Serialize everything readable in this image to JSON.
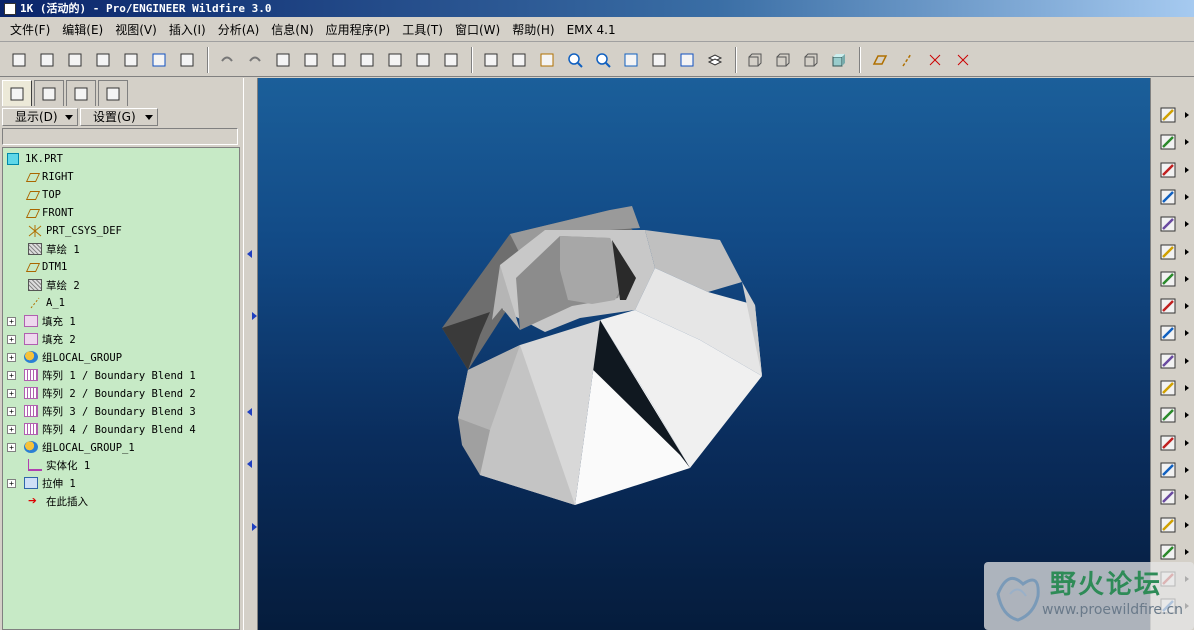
{
  "window": {
    "title": "1K (活动的) - Pro/ENGINEER Wildfire 3.0"
  },
  "menu": [
    "文件(F)",
    "编辑(E)",
    "视图(V)",
    "插入(I)",
    "分析(A)",
    "信息(N)",
    "应用程序(P)",
    "工具(T)",
    "窗口(W)",
    "帮助(H)",
    "EMX 4.1"
  ],
  "toolbar": {
    "groups": [
      [
        "new-icon",
        "open-icon",
        "close-window-icon",
        "check-icon",
        "edit-icon",
        "save-icon",
        "print-icon"
      ],
      [
        "undo-icon",
        "redo-icon",
        "cut-icon",
        "copy-icon",
        "paste-icon",
        "paste-special-icon",
        "regenerate-icon",
        "find-icon",
        "select-box-icon"
      ],
      [
        "spin-center-icon",
        "view-manager-icon",
        "datum-csys-icon",
        "zoom-in-icon",
        "zoom-out-icon",
        "refit-icon",
        "reorient-icon",
        "saved-views-icon",
        "layers-icon"
      ],
      [
        "wireframe-icon",
        "hidden-line-icon",
        "no-hidden-icon",
        "shading-icon"
      ],
      [
        "datum-planes-icon",
        "datum-axes-icon",
        "datum-points-icon",
        "csys-display-icon"
      ]
    ]
  },
  "panel": {
    "tabs": [
      "model-tree-icon",
      "folder-browser-icon",
      "favorites-icon",
      "connections-icon"
    ],
    "show_label": "显示(D)",
    "settings_label": "设置(G)"
  },
  "tree": [
    {
      "icon": "part-icon",
      "label": "1K.PRT",
      "expander": "",
      "level": 0
    },
    {
      "icon": "datum-plane-icon",
      "label": "RIGHT",
      "expander": "",
      "level": 1
    },
    {
      "icon": "datum-plane-icon",
      "label": "TOP",
      "expander": "",
      "level": 1
    },
    {
      "icon": "datum-plane-icon",
      "label": "FRONT",
      "expander": "",
      "level": 1
    },
    {
      "icon": "csys-icon",
      "label": "PRT_CSYS_DEF",
      "expander": "",
      "level": 1
    },
    {
      "icon": "sketch-icon",
      "label": "草绘 1",
      "expander": "",
      "level": 1
    },
    {
      "icon": "datum-plane-icon",
      "label": "DTM1",
      "expander": "",
      "level": 1
    },
    {
      "icon": "sketch-icon",
      "label": "草绘 2",
      "expander": "",
      "level": 1
    },
    {
      "icon": "axis-icon",
      "label": "A_1",
      "expander": "",
      "level": 1
    },
    {
      "icon": "fill-icon",
      "label": "填充 1",
      "expander": "+",
      "level": 1
    },
    {
      "icon": "fill-icon",
      "label": "填充 2",
      "expander": "+",
      "level": 1
    },
    {
      "icon": "group-icon",
      "label": "组LOCAL_GROUP",
      "expander": "+",
      "level": 1
    },
    {
      "icon": "pattern-icon",
      "label": "阵列 1 / Boundary Blend 1",
      "expander": "+",
      "level": 1
    },
    {
      "icon": "pattern-icon",
      "label": "阵列 2 / Boundary Blend 2",
      "expander": "+",
      "level": 1
    },
    {
      "icon": "pattern-icon",
      "label": "阵列 3 / Boundary Blend 3",
      "expander": "+",
      "level": 1
    },
    {
      "icon": "pattern-icon",
      "label": "阵列 4 / Boundary Blend 4",
      "expander": "+",
      "level": 1
    },
    {
      "icon": "group-icon",
      "label": "组LOCAL_GROUP_1",
      "expander": "+",
      "level": 1
    },
    {
      "icon": "solidify-icon",
      "label": "实体化 1",
      "expander": "",
      "level": 1
    },
    {
      "icon": "extrude-icon",
      "label": "拉伸 1",
      "expander": "+",
      "level": 1
    },
    {
      "icon": "insert-here-icon",
      "label": "在此插入",
      "expander": "",
      "level": 1
    }
  ],
  "right_toolbar": [
    "new-udf-icon",
    "feature-tool-icon",
    "hole-tool-icon",
    "round-tool-icon",
    "chamfer-tool-icon",
    "edge-chamfer-icon",
    "draft-tool-icon",
    "shell-tool-icon",
    "rib-tool-icon",
    "pattern-tool-icon",
    "copy-paste-icon",
    "mirror-tool-icon",
    "merge-tool-icon",
    "trim-tool-icon",
    "extend-tool-icon",
    "offset-tool-icon",
    "thicken-tool-icon",
    "solidify-tool-icon",
    "sketch-tool-icon"
  ],
  "watermark": {
    "title": "野火论坛",
    "url": "www.proewildfire.cn"
  }
}
